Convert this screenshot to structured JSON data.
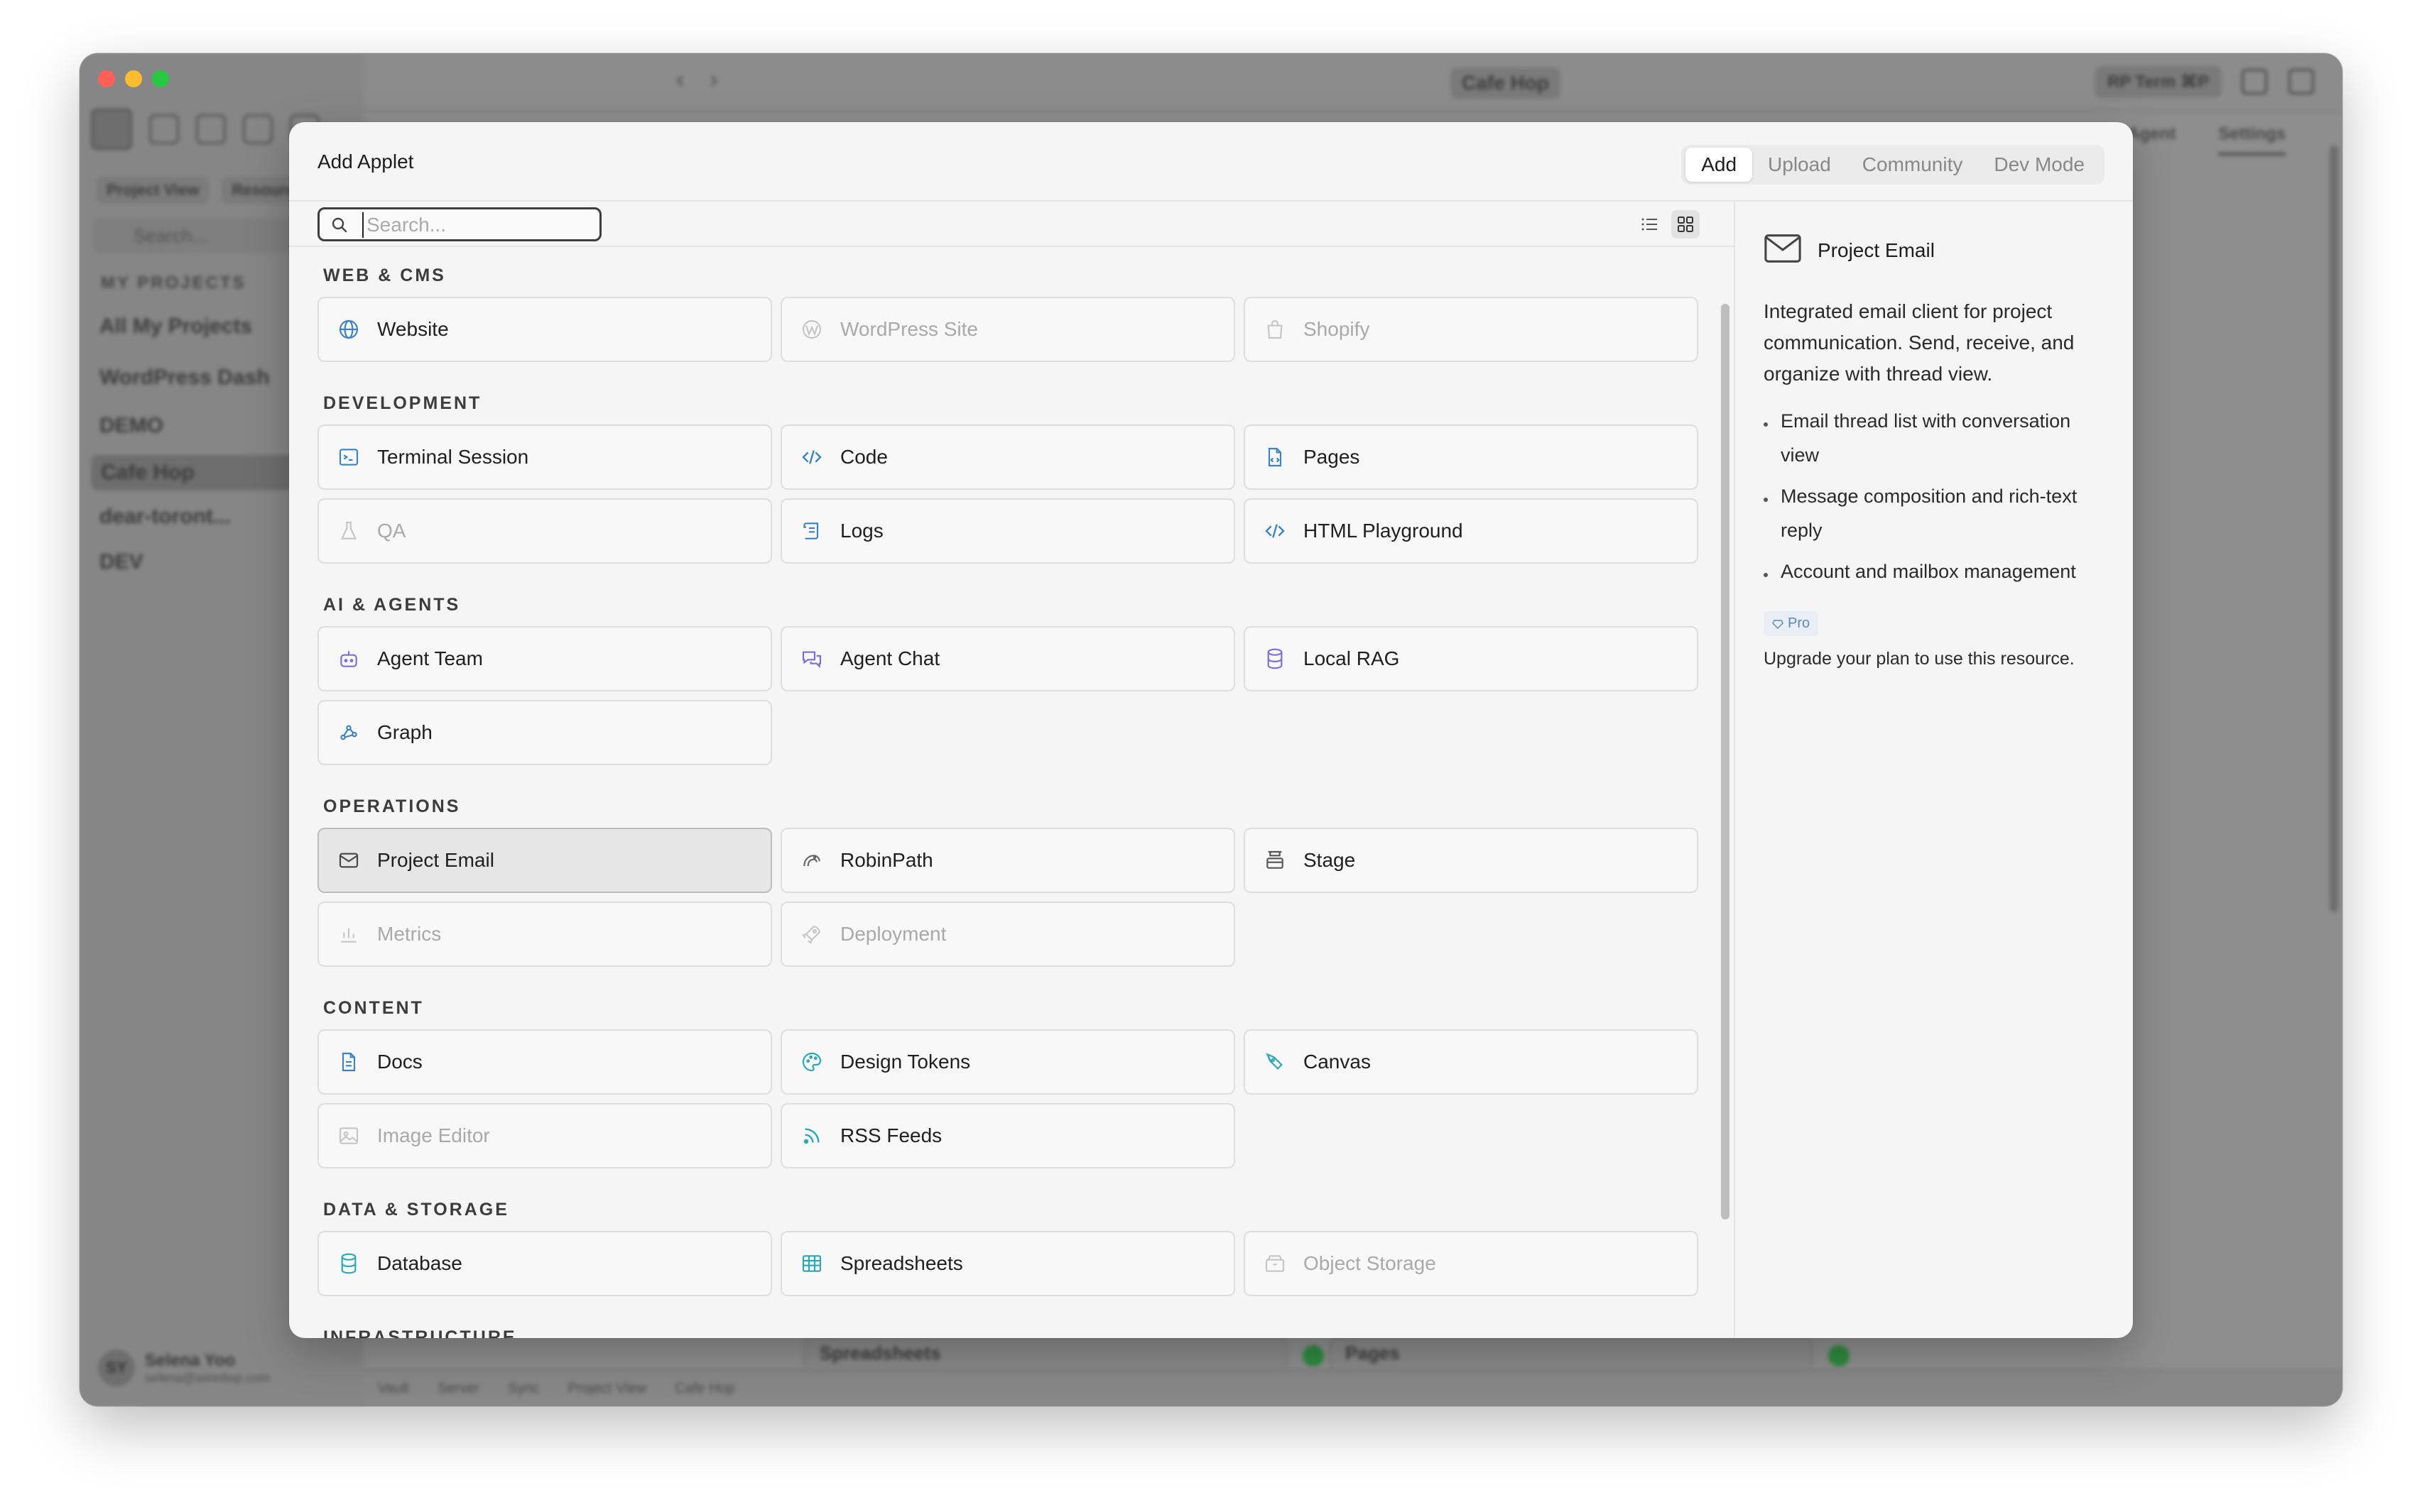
{
  "background": {
    "window_title": "Cafe Hop",
    "term_chip": "RP Term  ⌘P",
    "right_tabs": [
      "Agent",
      "Settings"
    ],
    "sidebar_tabs": [
      "Project View",
      "Resourc"
    ],
    "search_placeholder": "Search...",
    "section": "MY PROJECTS",
    "projects": [
      "All My Projects",
      "WordPress Dash",
      "DEMO",
      "Cafe Hop",
      "dear-toront...",
      "DEV"
    ],
    "user": {
      "initials": "SY",
      "name": "Selena Yoo",
      "email": "selena@wiredwp.com"
    },
    "status_items": [
      "Vault",
      "Server",
      "Sync",
      "Project View",
      "Cafe Hop"
    ],
    "bottom_cards": [
      "Spreadsheets",
      "Pages"
    ]
  },
  "modal": {
    "title": "Add Applet",
    "tabs": [
      "Add",
      "Upload",
      "Community",
      "Dev Mode"
    ],
    "active_tab": "Add",
    "search": {
      "placeholder": "Search...",
      "value": ""
    },
    "view_mode": "grid",
    "sections": [
      {
        "label": "WEB & CMS",
        "items": [
          {
            "label": "Website",
            "icon": "globe-icon",
            "disabled": false
          },
          {
            "label": "WordPress Site",
            "icon": "wordpress-icon",
            "disabled": true
          },
          {
            "label": "Shopify",
            "icon": "shopify-icon",
            "disabled": true
          }
        ]
      },
      {
        "label": "DEVELOPMENT",
        "items": [
          {
            "label": "Terminal Session",
            "icon": "terminal-icon",
            "disabled": false
          },
          {
            "label": "Code",
            "icon": "code-icon",
            "disabled": false
          },
          {
            "label": "Pages",
            "icon": "pages-icon",
            "disabled": false
          },
          {
            "label": "QA",
            "icon": "flask-icon",
            "disabled": true
          },
          {
            "label": "Logs",
            "icon": "scroll-icon",
            "disabled": false
          },
          {
            "label": "HTML Playground",
            "icon": "code-icon",
            "disabled": false
          }
        ]
      },
      {
        "label": "AI & AGENTS",
        "items": [
          {
            "label": "Agent Team",
            "icon": "bot-icon",
            "disabled": false
          },
          {
            "label": "Agent Chat",
            "icon": "chat-icon",
            "disabled": false
          },
          {
            "label": "Local RAG",
            "icon": "database-icon",
            "disabled": false
          },
          {
            "label": "Graph",
            "icon": "graph-icon",
            "disabled": false
          }
        ]
      },
      {
        "label": "OPERATIONS",
        "items": [
          {
            "label": "Project Email",
            "icon": "mail-icon",
            "disabled": false,
            "selected": true
          },
          {
            "label": "RobinPath",
            "icon": "bird-icon",
            "disabled": false
          },
          {
            "label": "Stage",
            "icon": "stage-icon",
            "disabled": false
          },
          {
            "label": "Metrics",
            "icon": "bar-chart-icon",
            "disabled": true
          },
          {
            "label": "Deployment",
            "icon": "rocket-icon",
            "disabled": true
          }
        ]
      },
      {
        "label": "CONTENT",
        "items": [
          {
            "label": "Docs",
            "icon": "document-icon",
            "disabled": false
          },
          {
            "label": "Design Tokens",
            "icon": "palette-icon",
            "disabled": false
          },
          {
            "label": "Canvas",
            "icon": "pen-icon",
            "disabled": false
          },
          {
            "label": "Image Editor",
            "icon": "image-icon",
            "disabled": true
          },
          {
            "label": "RSS Feeds",
            "icon": "rss-icon",
            "disabled": false
          }
        ]
      },
      {
        "label": "DATA & STORAGE",
        "items": [
          {
            "label": "Database",
            "icon": "database-icon",
            "disabled": false
          },
          {
            "label": "Spreadsheets",
            "icon": "table-icon",
            "disabled": false
          },
          {
            "label": "Object Storage",
            "icon": "archive-icon",
            "disabled": true
          }
        ]
      },
      {
        "label": "INFRASTRUCTURE",
        "items": []
      }
    ],
    "detail": {
      "title": "Project Email",
      "icon": "mail-icon",
      "description": "Integrated email client for project communication. Send, receive, and organize with thread view.",
      "features": [
        "Email thread list with conversation view",
        "Message composition and rich-text reply",
        "Account and mailbox management"
      ],
      "badge": "Pro",
      "upgrade_text": "Upgrade your plan to use this resource."
    }
  },
  "colors": {
    "accent_blue": "#3b82c4",
    "accent_purple": "#7b6cd9",
    "accent_teal": "#2aa7b8",
    "disabled": "#a9a9a9"
  }
}
